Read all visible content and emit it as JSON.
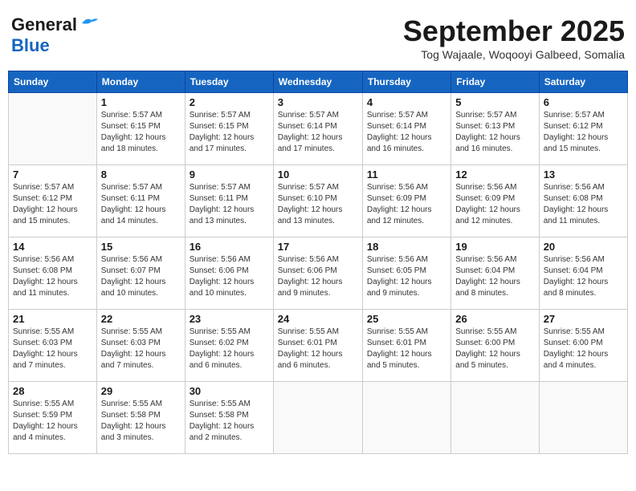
{
  "logo": {
    "line1": "General",
    "line2": "Blue"
  },
  "title": "September 2025",
  "location": "Tog Wajaale, Woqooyi Galbeed, Somalia",
  "days_of_week": [
    "Sunday",
    "Monday",
    "Tuesday",
    "Wednesday",
    "Thursday",
    "Friday",
    "Saturday"
  ],
  "weeks": [
    [
      {
        "day": "",
        "info": ""
      },
      {
        "day": "1",
        "info": "Sunrise: 5:57 AM\nSunset: 6:15 PM\nDaylight: 12 hours\nand 18 minutes."
      },
      {
        "day": "2",
        "info": "Sunrise: 5:57 AM\nSunset: 6:15 PM\nDaylight: 12 hours\nand 17 minutes."
      },
      {
        "day": "3",
        "info": "Sunrise: 5:57 AM\nSunset: 6:14 PM\nDaylight: 12 hours\nand 17 minutes."
      },
      {
        "day": "4",
        "info": "Sunrise: 5:57 AM\nSunset: 6:14 PM\nDaylight: 12 hours\nand 16 minutes."
      },
      {
        "day": "5",
        "info": "Sunrise: 5:57 AM\nSunset: 6:13 PM\nDaylight: 12 hours\nand 16 minutes."
      },
      {
        "day": "6",
        "info": "Sunrise: 5:57 AM\nSunset: 6:12 PM\nDaylight: 12 hours\nand 15 minutes."
      }
    ],
    [
      {
        "day": "7",
        "info": "Sunrise: 5:57 AM\nSunset: 6:12 PM\nDaylight: 12 hours\nand 15 minutes."
      },
      {
        "day": "8",
        "info": "Sunrise: 5:57 AM\nSunset: 6:11 PM\nDaylight: 12 hours\nand 14 minutes."
      },
      {
        "day": "9",
        "info": "Sunrise: 5:57 AM\nSunset: 6:11 PM\nDaylight: 12 hours\nand 13 minutes."
      },
      {
        "day": "10",
        "info": "Sunrise: 5:57 AM\nSunset: 6:10 PM\nDaylight: 12 hours\nand 13 minutes."
      },
      {
        "day": "11",
        "info": "Sunrise: 5:56 AM\nSunset: 6:09 PM\nDaylight: 12 hours\nand 12 minutes."
      },
      {
        "day": "12",
        "info": "Sunrise: 5:56 AM\nSunset: 6:09 PM\nDaylight: 12 hours\nand 12 minutes."
      },
      {
        "day": "13",
        "info": "Sunrise: 5:56 AM\nSunset: 6:08 PM\nDaylight: 12 hours\nand 11 minutes."
      }
    ],
    [
      {
        "day": "14",
        "info": "Sunrise: 5:56 AM\nSunset: 6:08 PM\nDaylight: 12 hours\nand 11 minutes."
      },
      {
        "day": "15",
        "info": "Sunrise: 5:56 AM\nSunset: 6:07 PM\nDaylight: 12 hours\nand 10 minutes."
      },
      {
        "day": "16",
        "info": "Sunrise: 5:56 AM\nSunset: 6:06 PM\nDaylight: 12 hours\nand 10 minutes."
      },
      {
        "day": "17",
        "info": "Sunrise: 5:56 AM\nSunset: 6:06 PM\nDaylight: 12 hours\nand 9 minutes."
      },
      {
        "day": "18",
        "info": "Sunrise: 5:56 AM\nSunset: 6:05 PM\nDaylight: 12 hours\nand 9 minutes."
      },
      {
        "day": "19",
        "info": "Sunrise: 5:56 AM\nSunset: 6:04 PM\nDaylight: 12 hours\nand 8 minutes."
      },
      {
        "day": "20",
        "info": "Sunrise: 5:56 AM\nSunset: 6:04 PM\nDaylight: 12 hours\nand 8 minutes."
      }
    ],
    [
      {
        "day": "21",
        "info": "Sunrise: 5:55 AM\nSunset: 6:03 PM\nDaylight: 12 hours\nand 7 minutes."
      },
      {
        "day": "22",
        "info": "Sunrise: 5:55 AM\nSunset: 6:03 PM\nDaylight: 12 hours\nand 7 minutes."
      },
      {
        "day": "23",
        "info": "Sunrise: 5:55 AM\nSunset: 6:02 PM\nDaylight: 12 hours\nand 6 minutes."
      },
      {
        "day": "24",
        "info": "Sunrise: 5:55 AM\nSunset: 6:01 PM\nDaylight: 12 hours\nand 6 minutes."
      },
      {
        "day": "25",
        "info": "Sunrise: 5:55 AM\nSunset: 6:01 PM\nDaylight: 12 hours\nand 5 minutes."
      },
      {
        "day": "26",
        "info": "Sunrise: 5:55 AM\nSunset: 6:00 PM\nDaylight: 12 hours\nand 5 minutes."
      },
      {
        "day": "27",
        "info": "Sunrise: 5:55 AM\nSunset: 6:00 PM\nDaylight: 12 hours\nand 4 minutes."
      }
    ],
    [
      {
        "day": "28",
        "info": "Sunrise: 5:55 AM\nSunset: 5:59 PM\nDaylight: 12 hours\nand 4 minutes."
      },
      {
        "day": "29",
        "info": "Sunrise: 5:55 AM\nSunset: 5:58 PM\nDaylight: 12 hours\nand 3 minutes."
      },
      {
        "day": "30",
        "info": "Sunrise: 5:55 AM\nSunset: 5:58 PM\nDaylight: 12 hours\nand 2 minutes."
      },
      {
        "day": "",
        "info": ""
      },
      {
        "day": "",
        "info": ""
      },
      {
        "day": "",
        "info": ""
      },
      {
        "day": "",
        "info": ""
      }
    ]
  ]
}
